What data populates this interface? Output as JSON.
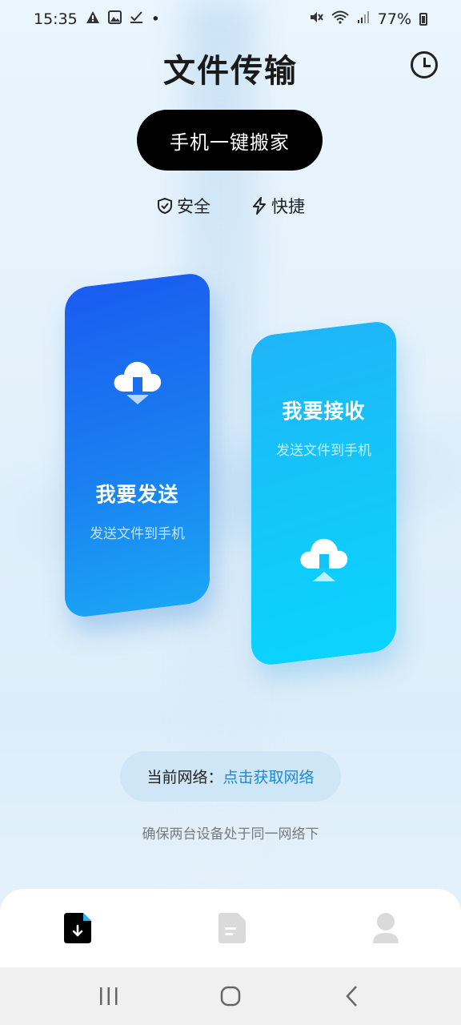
{
  "status_bar": {
    "time": "15:35",
    "dot": "•",
    "battery": "77%",
    "left_icons": [
      "warning-icon",
      "image-icon",
      "check-icon"
    ],
    "right_icons": [
      "mute-icon",
      "wifi-icon",
      "signal-icon",
      "battery-icon"
    ]
  },
  "header": {
    "title": "文件传输",
    "history_icon": "clock-icon"
  },
  "migrate_button": "手机一键搬家",
  "features": [
    {
      "icon": "shield-icon",
      "label": "安全"
    },
    {
      "icon": "lightning-icon",
      "label": "快捷"
    }
  ],
  "cards": {
    "send": {
      "title": "我要发送",
      "subtitle": "发送文件到手机",
      "icon": "cloud-download-icon"
    },
    "receive": {
      "title": "我要接收",
      "subtitle": "发送文件到手机",
      "icon": "cloud-upload-icon"
    }
  },
  "network": {
    "label": "当前网络：",
    "link": "点击获取网络",
    "hint": "确保两台设备处于同一网络下"
  },
  "bottom_nav": [
    {
      "icon": "file-transfer-icon",
      "active": true
    },
    {
      "icon": "document-icon",
      "active": false
    },
    {
      "icon": "profile-icon",
      "active": false
    }
  ],
  "colors": {
    "send_card": "#1a6ff0",
    "receive_card": "#12c4f8",
    "link": "#1a8ad8",
    "primary_button": "#000000"
  }
}
